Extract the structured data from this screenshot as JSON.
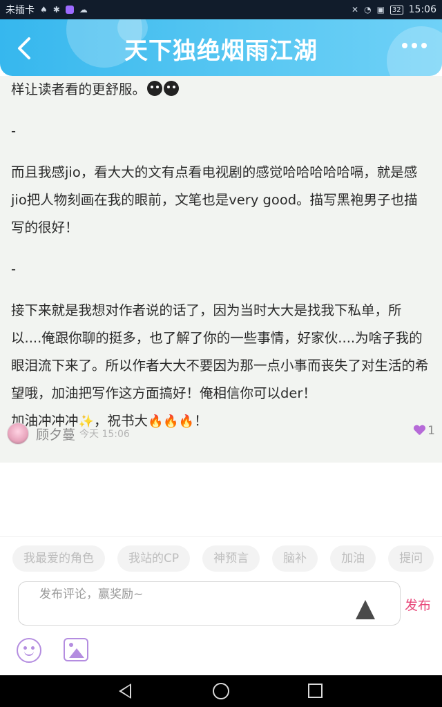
{
  "status_bar": {
    "carrier": "未插卡",
    "battery": "32",
    "time": "15:06"
  },
  "header": {
    "title": "天下独绝烟雨江湖",
    "back_icon": "chevron-left-icon",
    "more_icon": "more-dots-icon"
  },
  "comment": {
    "line1": "样让读者看的更舒服。",
    "dash1": "-",
    "para2": "而且我感jio，看大大的文有点看电视剧的感觉哈哈哈哈哈嗝，就是感jio把人物刻画在我的眼前，文笔也是very good。描写黑袍男子也描写的很好！",
    "dash2": "-",
    "para3": "接下来就是我想对作者说的话了，因为当时大大是找我下私单，所以....俺跟你聊的挺多，也了解了你的一些事情，好家伙....为啥子我的眼泪流下来了。所以作者大大不要因为那一点小事而丧失了对生活的希望哦，加油把写作这方面搞好！俺相信你可以der！",
    "para4_a": "加油冲冲冲",
    "sparkle": "✨",
    "para4_b": "，祝书大",
    "fires": "🔥🔥🔥",
    "para4_end": "！",
    "author": "顾夕蔓",
    "time": "今天 15:06",
    "likes": "1"
  },
  "tags": [
    "我最爱的角色",
    "我站的CP",
    "神预言",
    "脑补",
    "加油",
    "提问"
  ],
  "input": {
    "placeholder": "发布评论，赢奖励~",
    "publish_label": "发布"
  },
  "colors": {
    "header_start": "#36b7ee",
    "header_end": "#6fd1f7",
    "publish": "#e8487a",
    "accent_purple": "#b48de0"
  }
}
